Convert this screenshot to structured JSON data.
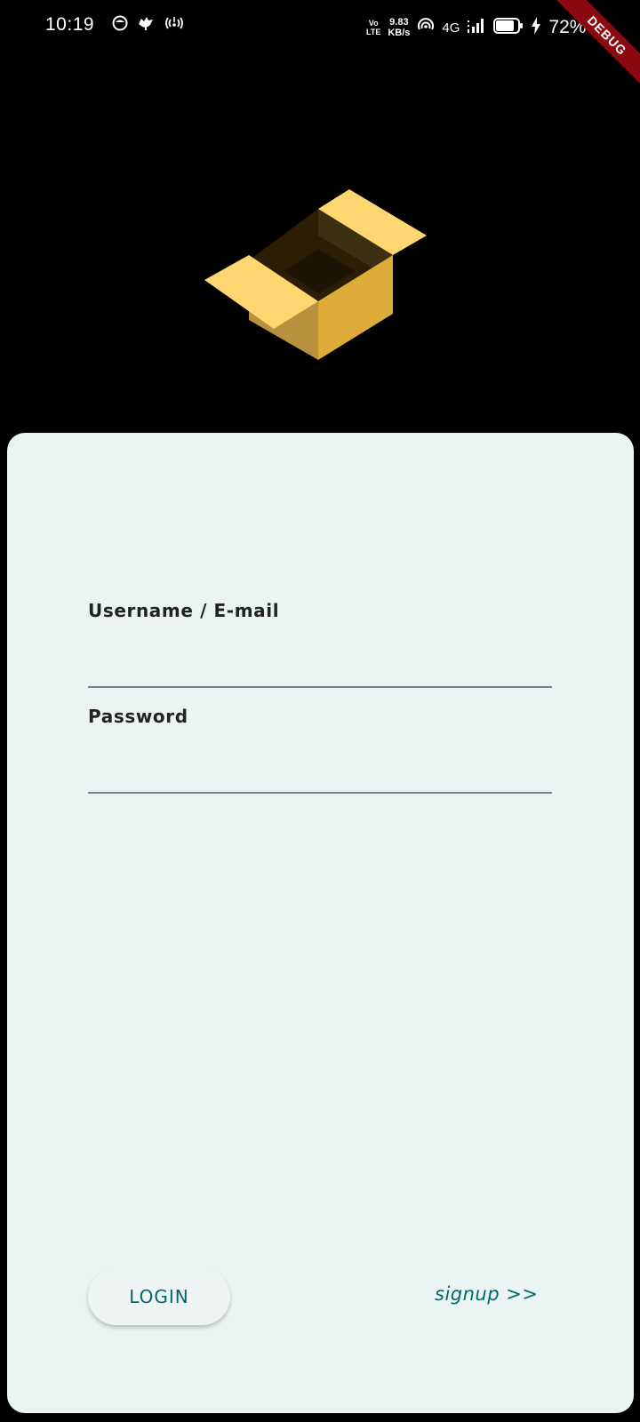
{
  "status_bar": {
    "time": "10:19",
    "left_icons": [
      "camera-app-icon",
      "bird-app-icon",
      "hotspot-icon"
    ],
    "volte_line1": "Vo",
    "volte_line2": "LTE",
    "speed_value": "9.83",
    "speed_unit": "KB/s",
    "network_type": "4G",
    "battery_percent": "72%",
    "right_icons": [
      "volte-icon",
      "hotspot-signal-icon",
      "cell-signal-icon",
      "battery-icon",
      "charging-bolt-icon"
    ]
  },
  "debug_banner": "DEBUG",
  "logo": {
    "icon": "open-box-icon",
    "colors": {
      "flap_light": "#ffd66f",
      "side_right": "#ddab38",
      "side_left": "#b8913f",
      "inside_dark": "#2b1e04"
    }
  },
  "login_form": {
    "username_label": "Username / E-mail",
    "username_value": "",
    "username_placeholder": "",
    "password_label": "Password",
    "password_value": "",
    "password_placeholder": "",
    "login_button_label": "LOGIN",
    "signup_link_label": "signup >>"
  },
  "colors": {
    "background": "#000000",
    "card": "#ecf4f3",
    "accent": "#00686d",
    "label_text": "#222222",
    "underline": "#7a8288"
  }
}
